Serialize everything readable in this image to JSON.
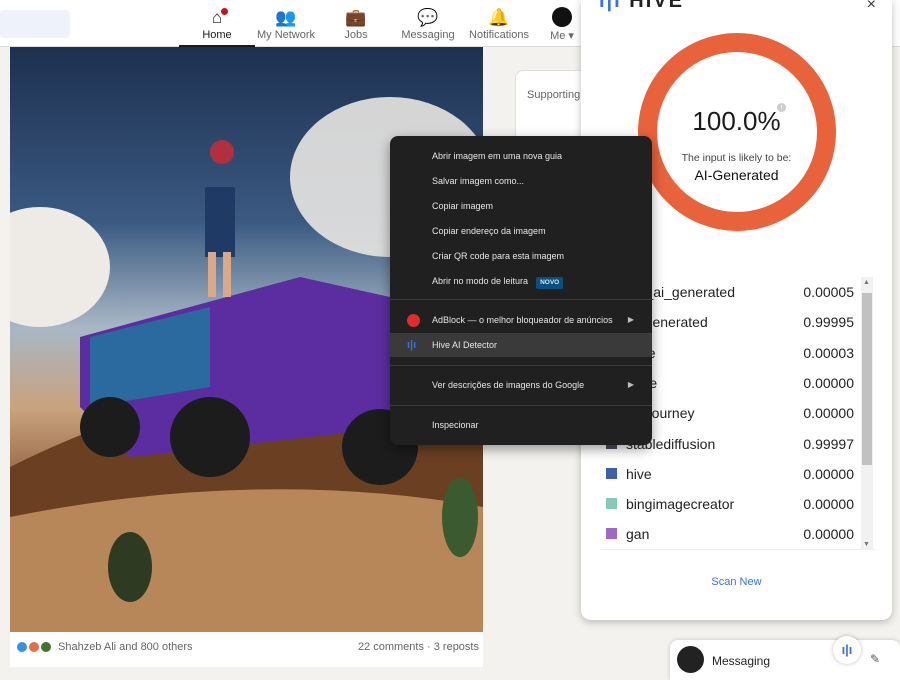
{
  "nav": {
    "items": [
      {
        "label": "Home",
        "icon": "home-icon"
      },
      {
        "label": "My Network",
        "icon": "network-icon"
      },
      {
        "label": "Jobs",
        "icon": "briefcase-icon"
      },
      {
        "label": "Messaging",
        "icon": "chat-icon"
      },
      {
        "label": "Notifications",
        "icon": "bell-icon"
      },
      {
        "label": "Me",
        "icon": "avatar"
      }
    ]
  },
  "post": {
    "reactions_text": "Shahzeb Ali and 800 others",
    "counts": "22 comments · 3 reposts"
  },
  "right_card": {
    "text": "Supporting"
  },
  "hive": {
    "logo": "HIVE",
    "close": "×",
    "percent": "100.0%",
    "likely_label": "The input is likely to be:",
    "verdict": "AI-Generated",
    "ring_color": "#e8623c",
    "scan_new": "Scan New",
    "results": [
      {
        "label": "not_ai_generated",
        "value": "0.00005",
        "color": "#555555"
      },
      {
        "label": "ai_generated",
        "value": "0.99995",
        "color": "#555555"
      },
      {
        "label": "dalle",
        "value": "0.00003",
        "color": "#555555"
      },
      {
        "label": "none",
        "value": "0.00000",
        "color": "#555555"
      },
      {
        "label": "midjourney",
        "value": "0.00000",
        "color": "#555555"
      },
      {
        "label": "stablediffusion",
        "value": "0.99997",
        "color": "#4a5060"
      },
      {
        "label": "hive",
        "value": "0.00000",
        "color": "#3f5fa8"
      },
      {
        "label": "bingimagecreator",
        "value": "0.00000",
        "color": "#86c9b8"
      },
      {
        "label": "gan",
        "value": "0.00000",
        "color": "#9c6ac4"
      }
    ]
  },
  "context_menu": {
    "items": [
      "Abrir imagem em uma nova guia",
      "Salvar imagem como...",
      "Copiar imagem",
      "Copiar endereço da imagem",
      "Criar QR code para esta imagem",
      "Abrir no modo de leitura"
    ],
    "novo_badge": "NOVO",
    "adblock": "AdBlock — o melhor bloqueador de anúncios",
    "hive_detector": "Hive AI Detector",
    "google": "Ver descrições de imagens do Google",
    "inspect": "Inspecionar"
  },
  "messaging": {
    "label": "Messaging"
  }
}
